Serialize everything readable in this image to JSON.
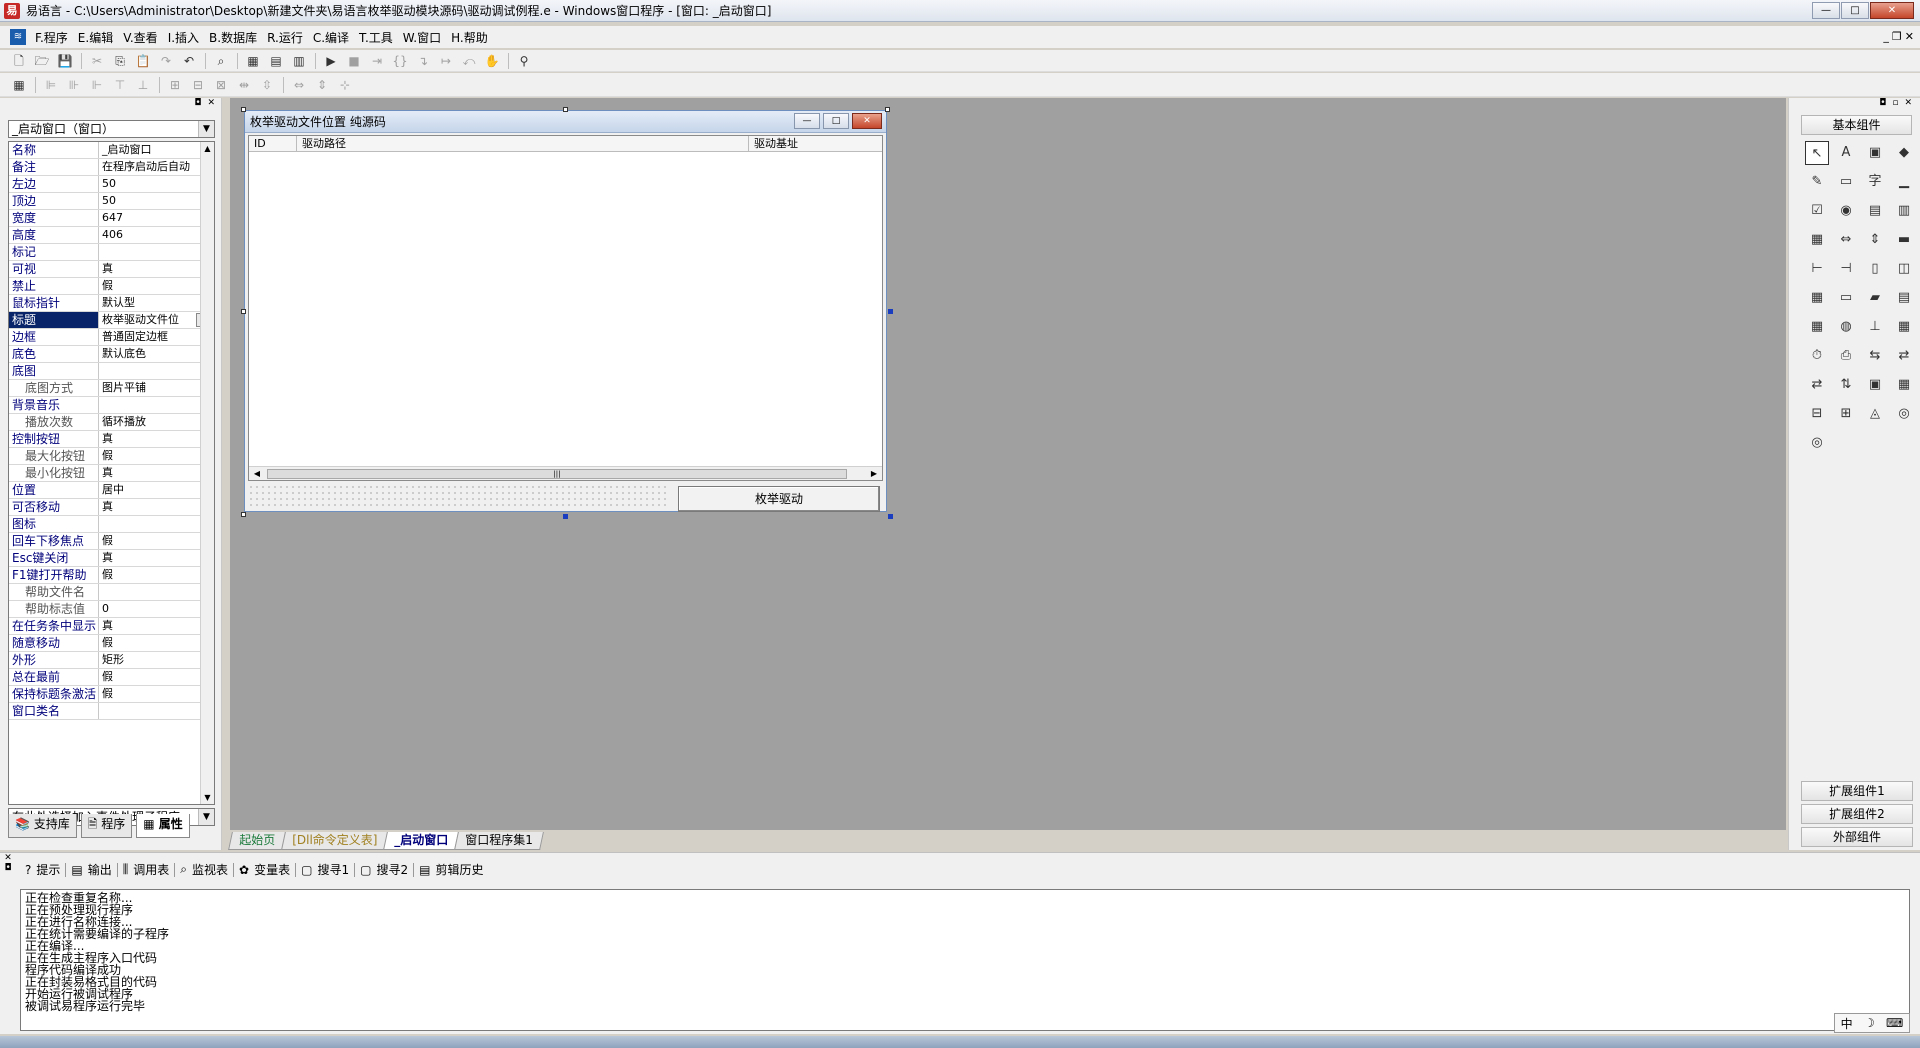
{
  "window": {
    "app_icon": "易",
    "title": "易语言 - C:\\Users\\Administrator\\Desktop\\新建文件夹\\易语言枚举驱动模块源码\\驱动调试例程.e - Windows窗口程序 - [窗口: _启动窗口]",
    "buttons": [
      "—",
      "□",
      "✕"
    ]
  },
  "menubar": {
    "items": [
      "F.程序",
      "E.编辑",
      "V.查看",
      "I.插入",
      "B.数据库",
      "R.运行",
      "C.编译",
      "T.工具",
      "W.窗口",
      "H.帮助"
    ],
    "mdi_buttons": [
      "_",
      "❐",
      "✕"
    ]
  },
  "toolbar1": {
    "icons": [
      "new-file-icon",
      "open-folder-icon",
      "save-icon",
      "cut-icon",
      "copy-icon",
      "paste-icon",
      "redo-icon",
      "undo-icon",
      "find-icon",
      "layout1-icon",
      "layout2-icon",
      "layout3-icon",
      "run-icon",
      "stop-icon",
      "step-icon",
      "step-into-icon",
      "step-out-icon",
      "run-to-icon",
      "step-back-icon",
      "hand-icon",
      "binoculars-icon"
    ]
  },
  "toolbar2": {
    "icons": [
      "calc-icon",
      "align-left-icon",
      "align-center-h-icon",
      "align-right-icon",
      "align-top-icon",
      "align-middle-icon",
      "align-bottom-icon",
      "same-width-icon",
      "same-height-icon",
      "same-size-icon",
      "space-h-icon",
      "space-v-icon",
      "center-h-icon",
      "center-v-icon",
      "center-both-icon"
    ]
  },
  "left_panel": {
    "object_combo": "_启动窗口（窗口）",
    "properties": [
      {
        "name": "名称",
        "value": "_启动窗口",
        "sub": false
      },
      {
        "name": "备注",
        "value": "在程序启动后自动",
        "sub": false
      },
      {
        "name": "左边",
        "value": "50",
        "sub": false
      },
      {
        "name": "顶边",
        "value": "50",
        "sub": false
      },
      {
        "name": "宽度",
        "value": "647",
        "sub": false
      },
      {
        "name": "高度",
        "value": "406",
        "sub": false
      },
      {
        "name": "标记",
        "value": "",
        "sub": false
      },
      {
        "name": "可视",
        "value": "真",
        "sub": false
      },
      {
        "name": "禁止",
        "value": "假",
        "sub": false
      },
      {
        "name": "鼠标指针",
        "value": "默认型",
        "sub": false
      },
      {
        "name": "标题",
        "value": "枚举驱动文件位",
        "sub": false,
        "selected": true
      },
      {
        "name": "边框",
        "value": "普通固定边框",
        "sub": false
      },
      {
        "name": "底色",
        "value": "默认底色",
        "sub": false
      },
      {
        "name": "底图",
        "value": "",
        "sub": false
      },
      {
        "name": "底图方式",
        "value": "图片平铺",
        "sub": true
      },
      {
        "name": "背景音乐",
        "value": "",
        "sub": false
      },
      {
        "name": "播放次数",
        "value": "循环播放",
        "sub": true
      },
      {
        "name": "控制按钮",
        "value": "真",
        "sub": false
      },
      {
        "name": "最大化按钮",
        "value": "假",
        "sub": true
      },
      {
        "name": "最小化按钮",
        "value": "真",
        "sub": true
      },
      {
        "name": "位置",
        "value": "居中",
        "sub": false
      },
      {
        "name": "可否移动",
        "value": "真",
        "sub": false
      },
      {
        "name": "图标",
        "value": "",
        "sub": false
      },
      {
        "name": "回车下移焦点",
        "value": "假",
        "sub": false
      },
      {
        "name": "Esc键关闭",
        "value": "真",
        "sub": false
      },
      {
        "name": "F1键打开帮助",
        "value": "假",
        "sub": false
      },
      {
        "name": "帮助文件名",
        "value": "",
        "sub": true
      },
      {
        "name": "帮助标志值",
        "value": "0",
        "sub": true
      },
      {
        "name": "在任务条中显示",
        "value": "真",
        "sub": false
      },
      {
        "name": "随意移动",
        "value": "假",
        "sub": false
      },
      {
        "name": "外形",
        "value": "矩形",
        "sub": false
      },
      {
        "name": "总在最前",
        "value": "假",
        "sub": false
      },
      {
        "name": "保持标题条激活",
        "value": "假",
        "sub": false
      },
      {
        "name": "窗口类名",
        "value": "",
        "sub": false
      }
    ],
    "event_combo": "在此处选择加入事件处理子程序",
    "tabs": [
      "支持库",
      "程序",
      "属性"
    ]
  },
  "form": {
    "title": "枚举驱动文件位置 纯源码",
    "columns": [
      "ID",
      "驱动路径",
      "驱动基址"
    ],
    "button": "枚举驱动"
  },
  "doc_tabs": [
    "起始页",
    "[Dll命令定义表]",
    "_启动窗口",
    "窗口程序集1"
  ],
  "right_panel": {
    "group_title": "基本组件",
    "groups_bottom": [
      "扩展组件1",
      "扩展组件2",
      "外部组件"
    ],
    "components": [
      "↖",
      "A",
      "▣",
      "◆",
      "✎",
      "▭",
      "字",
      "▁",
      "☑",
      "◉",
      "▤",
      "▥",
      "▦",
      "⇔",
      "⇕",
      "▬",
      "⊢",
      "⊣",
      "▯",
      "◫",
      "▦",
      "▭",
      "▰",
      "▤",
      "▦",
      "◍",
      "⊥",
      "▦",
      "⏱",
      "⎙",
      "⇆",
      "⇄",
      "⇄",
      "⇅",
      "▣",
      "▦",
      "⊟",
      "⊞",
      "◬",
      "◎",
      "◎"
    ]
  },
  "bottom_panel": {
    "tabs": [
      {
        "icon": "?",
        "label": "提示"
      },
      {
        "icon": "▤",
        "label": "输出"
      },
      {
        "icon": "⫼",
        "label": "调用表"
      },
      {
        "icon": "⌕",
        "label": "监视表"
      },
      {
        "icon": "✿",
        "label": "变量表"
      },
      {
        "icon": "▢",
        "label": "搜寻1"
      },
      {
        "icon": "▢",
        "label": "搜寻2"
      },
      {
        "icon": "▤",
        "label": "剪辑历史"
      }
    ],
    "output_lines": [
      "正在检查重复名称...",
      "正在预处理现行程序",
      "正在进行名称连接...",
      "正在统计需要编译的子程序",
      "正在编译...",
      "正在生成主程序入口代码",
      "程序代码编译成功",
      "正在封装易格式目的代码",
      "开始运行被调试程序",
      "被调试易程序运行完毕"
    ]
  },
  "ime": {
    "lang": "中",
    "mode": "☽"
  }
}
